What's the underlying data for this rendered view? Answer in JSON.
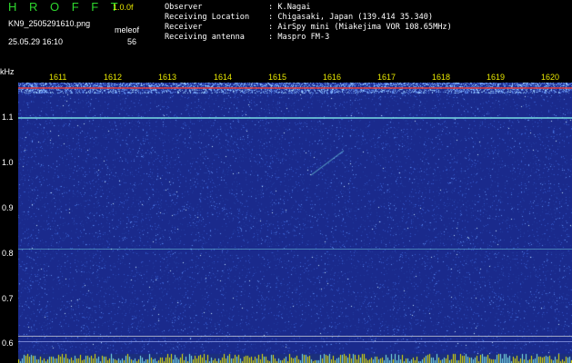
{
  "header": {
    "app_title": "H R O F F T",
    "app_version": "1.0.0f",
    "filename": "KN9_2505291610.png",
    "mode": "meleof",
    "datetime": "25.05.29 16:10",
    "count": "56"
  },
  "info": [
    {
      "key": "Observer",
      "value": ": K.Nagai"
    },
    {
      "key": "Receiving Location",
      "value": ": Chigasaki, Japan (139.414 35.340)"
    },
    {
      "key": "Receiver",
      "value": ": AirSpy mini (Miakejima VOR 108.65MHz)"
    },
    {
      "key": "Receiving antenna",
      "value": ": Maspro FM-3"
    }
  ],
  "spectrogram": {
    "unit_label": "kHz",
    "time_labels": [
      "1611",
      "1612",
      "1613",
      "1614",
      "1615",
      "1616",
      "1617",
      "1618",
      "1619",
      "1620"
    ],
    "freq_labels": [
      "1.1",
      "1.0",
      "0.9",
      "0.8",
      "0.7",
      "0.6"
    ],
    "colors": {
      "background": "#1a2a8c",
      "noise": "#3b6bd8",
      "line_red": "#e03a3a",
      "line_cyan": "#7fe8e8",
      "baseline": "#e8e800"
    }
  }
}
